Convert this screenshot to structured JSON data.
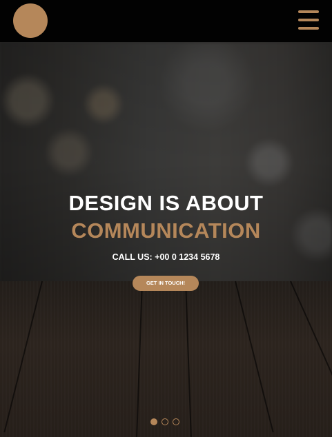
{
  "header": {
    "logo_icon": "circle-logo",
    "menu_icon": "hamburger-menu-icon"
  },
  "hero": {
    "title": "DESIGN IS ABOUT",
    "subtitle": "COMMUNICATION",
    "contact": "CALL US: +00 0 1234 5678",
    "cta_label": "GET IN TOUCH!"
  },
  "slider": {
    "slide_count": 3,
    "active_index": 0
  },
  "colors": {
    "accent": "#b5875a",
    "header_bg": "#020202",
    "text": "#ffffff"
  }
}
